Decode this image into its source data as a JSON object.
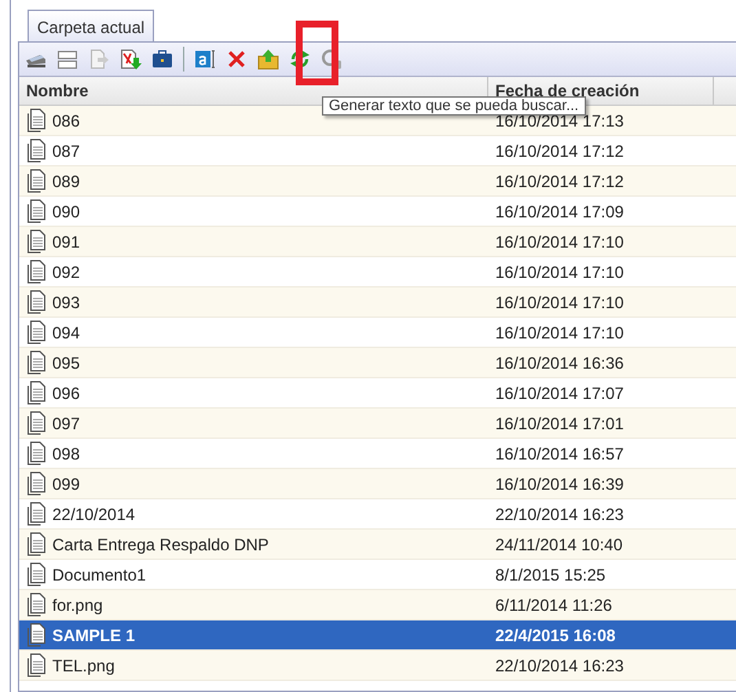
{
  "tab": {
    "label": "Carpeta actual",
    "selected": true
  },
  "tooltip": "Generar texto que se pueda buscar...",
  "table": {
    "columns": [
      "Nombre",
      "Fecha de creación"
    ],
    "rows": [
      {
        "name": "086",
        "date": "16/10/2014 17:13",
        "selected": false
      },
      {
        "name": "087",
        "date": "16/10/2014 17:12",
        "selected": false
      },
      {
        "name": "089",
        "date": "16/10/2014 17:12",
        "selected": false
      },
      {
        "name": "090",
        "date": "16/10/2014 17:09",
        "selected": false
      },
      {
        "name": "091",
        "date": "16/10/2014 17:10",
        "selected": false
      },
      {
        "name": "092",
        "date": "16/10/2014 17:10",
        "selected": false
      },
      {
        "name": "093",
        "date": "16/10/2014 17:10",
        "selected": false
      },
      {
        "name": "094",
        "date": "16/10/2014 17:10",
        "selected": false
      },
      {
        "name": "095",
        "date": "16/10/2014 16:36",
        "selected": false
      },
      {
        "name": "096",
        "date": "16/10/2014 17:07",
        "selected": false
      },
      {
        "name": "097",
        "date": "16/10/2014 17:01",
        "selected": false
      },
      {
        "name": "098",
        "date": "16/10/2014 16:57",
        "selected": false
      },
      {
        "name": "099",
        "date": "16/10/2014 16:39",
        "selected": false
      },
      {
        "name": "22/10/2014",
        "date": "22/10/2014 16:23",
        "selected": false
      },
      {
        "name": "Carta Entrega Respaldo DNP",
        "date": "24/11/2014 10:40",
        "selected": false
      },
      {
        "name": "Documento1",
        "date": "8/1/2015 15:25",
        "selected": false
      },
      {
        "name": "for.png",
        "date": "6/11/2014 11:26",
        "selected": false
      },
      {
        "name": "SAMPLE 1",
        "date": "22/4/2015 16:08",
        "selected": true
      },
      {
        "name": "TEL.png",
        "date": "22/10/2014 16:23",
        "selected": false
      }
    ]
  }
}
